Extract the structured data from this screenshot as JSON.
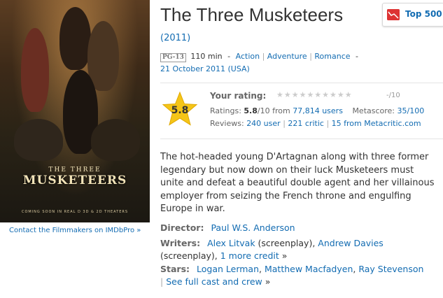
{
  "poster": {
    "title_small": "THE THREE",
    "title_large": "MUSKETEERS",
    "credit_line": "COMING SOON IN REAL D 3D & 2D THEATERS"
  },
  "pro_link": "Contact the Filmmakers on IMDbPro »",
  "title": "The Three Musketeers",
  "year": "(2011)",
  "top500": {
    "label": "Top 500",
    "icon": "chart-icon"
  },
  "info": {
    "certificate": "PG-13",
    "runtime": "110 min",
    "dash1": "-",
    "genres": [
      "Action",
      "Adventure",
      "Romance"
    ],
    "dash2": "-",
    "release": "21 October 2011 (USA)"
  },
  "rating": {
    "score": "5.8",
    "your_rating_label": "Your rating:",
    "your_stars": "★★★★★★★★★★",
    "your_score": "-/10",
    "ratings_label": "Ratings:",
    "ratings_value": "5.8",
    "ratings_scale": "/10 from",
    "ratings_users": "77,814 users",
    "metascore_label": "Metascore:",
    "metascore_value": "35/100",
    "reviews_label": "Reviews:",
    "reviews_user": "240 user",
    "reviews_critic": "221 critic",
    "reviews_from": "15 from",
    "reviews_site": "Metacritic.com"
  },
  "description": "The hot-headed young D'Artagnan along with three former legendary but now down on their luck Musketeers must unite and defeat a beautiful double agent and her villainous employer from seizing the French throne and engulfing Europe in war.",
  "credits": {
    "director_label": "Director:",
    "director": "Paul W.S. Anderson",
    "writers_label": "Writers:",
    "writer1": "Alex Litvak",
    "writer1_role": "(screenplay),",
    "writer2": "Andrew Davies",
    "writer2_role": "(screenplay),",
    "more_credit": "1 more credit",
    "more_arrow": "»",
    "stars_label": "Stars:",
    "star1": "Logan Lerman",
    "star2": "Matthew Macfadyen",
    "star3": "Ray Stevenson",
    "full_cast": "See full cast and crew",
    "full_cast_arrow": "»"
  },
  "colors": {
    "link": "#136cb2",
    "star_gold": "#f5c518"
  }
}
